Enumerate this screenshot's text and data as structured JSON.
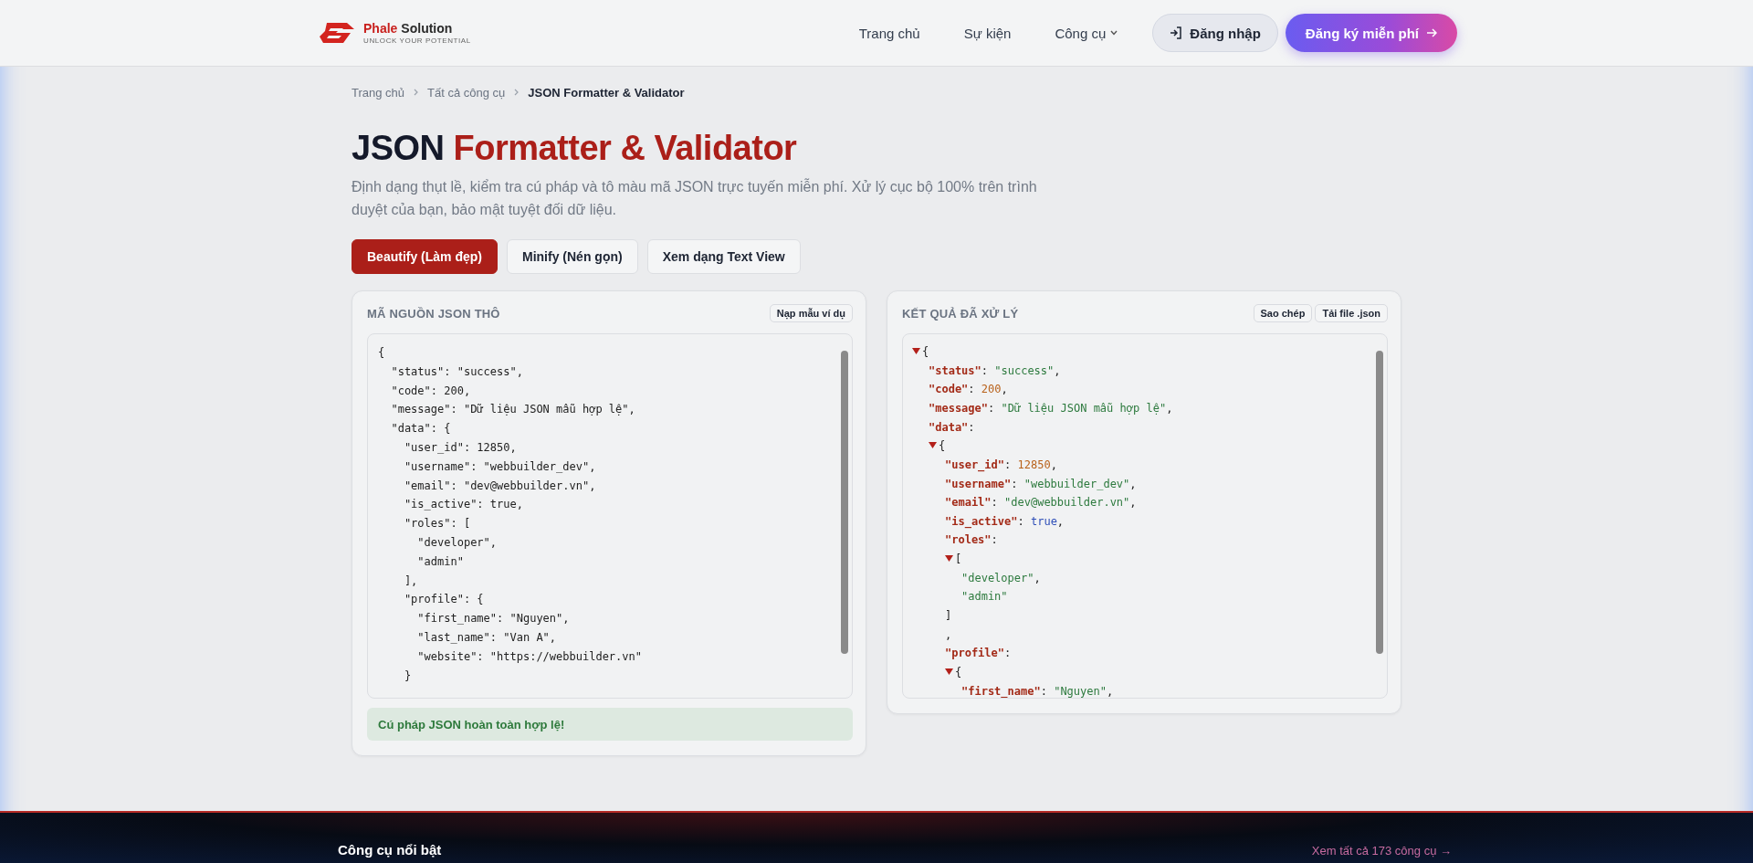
{
  "header": {
    "brand_primary": "Phale",
    "brand_secondary": "Solution",
    "tagline": "UNLOCK YOUR POTENTIAL",
    "nav": [
      {
        "label": "Trang chủ",
        "dropdown": false
      },
      {
        "label": "Sự kiện",
        "dropdown": false
      },
      {
        "label": "Công cụ",
        "dropdown": true
      }
    ],
    "login": "Đăng nhập",
    "signup": "Đăng ký miễn phí"
  },
  "breadcrumb": [
    "Trang chủ",
    "Tất cả công cụ",
    "JSON Formatter & Validator"
  ],
  "title": {
    "lead": "JSON",
    "accent": "Formatter & Validator"
  },
  "subtitle": "Định dạng thụt lề, kiểm tra cú pháp và tô màu mã JSON trực tuyến miễn phí. Xử lý cục bộ 100% trên trình duyệt của bạn, bảo mật tuyệt đối dữ liệu.",
  "modes": [
    {
      "label": "Beautify (Làm đẹp)",
      "selected": true
    },
    {
      "label": "Minify (Nén gọn)",
      "selected": false
    },
    {
      "label": "Xem dạng Text View",
      "selected": false
    }
  ],
  "input_panel": {
    "heading": "MÃ NGUỒN JSON THÔ",
    "action": "Nạp mẫu ví dụ",
    "value": "{\n  \"status\": \"success\",\n  \"code\": 200,\n  \"message\": \"Dữ liệu JSON mẫu hợp lệ\",\n  \"data\": {\n    \"user_id\": 12850,\n    \"username\": \"webbuilder_dev\",\n    \"email\": \"dev@webbuilder.vn\",\n    \"is_active\": true,\n    \"roles\": [\n      \"developer\",\n      \"admin\"\n    ],\n    \"profile\": {\n      \"first_name\": \"Nguyen\",\n      \"last_name\": \"Van A\",\n      \"website\": \"https://webbuilder.vn\"\n    }",
    "status": {
      "kind": "success",
      "text": "Cú pháp JSON hoàn toàn hợp lệ!"
    }
  },
  "output_panel": {
    "heading": "KẾT QUẢ ĐÃ XỬ LÝ",
    "actions": [
      "Sao chép",
      "Tải file .json"
    ],
    "tree": [
      {
        "expanded": true,
        "tokens": [
          {
            "kind": "punct",
            "text": "{"
          }
        ],
        "children": [
          {
            "tokens": [
              {
                "kind": "key",
                "text": "\"status\""
              },
              {
                "kind": "punct",
                "text": ":"
              },
              {
                "kind": "string",
                "text": "\"success\""
              },
              {
                "kind": "punct",
                "text": ","
              }
            ]
          },
          {
            "tokens": [
              {
                "kind": "key",
                "text": "\"code\""
              },
              {
                "kind": "punct",
                "text": ":"
              },
              {
                "kind": "number",
                "text": "200"
              },
              {
                "kind": "punct",
                "text": ","
              }
            ]
          },
          {
            "tokens": [
              {
                "kind": "key",
                "text": "\"message\""
              },
              {
                "kind": "punct",
                "text": ":"
              },
              {
                "kind": "string",
                "text": "\"Dữ liệu JSON mẫu hợp lệ\""
              },
              {
                "kind": "punct",
                "text": ","
              }
            ]
          },
          {
            "tokens": [
              {
                "kind": "key",
                "text": "\"data\""
              },
              {
                "kind": "punct",
                "text": ":"
              }
            ]
          },
          {
            "expanded": true,
            "tokens": [
              {
                "kind": "punct",
                "text": "{"
              }
            ],
            "children": [
              {
                "tokens": [
                  {
                    "kind": "key",
                    "text": "\"user_id\""
                  },
                  {
                    "kind": "punct",
                    "text": ":"
                  },
                  {
                    "kind": "number",
                    "text": "12850"
                  },
                  {
                    "kind": "punct",
                    "text": ","
                  }
                ]
              },
              {
                "tokens": [
                  {
                    "kind": "key",
                    "text": "\"username\""
                  },
                  {
                    "kind": "punct",
                    "text": ":"
                  },
                  {
                    "kind": "string",
                    "text": "\"webbuilder_dev\""
                  },
                  {
                    "kind": "punct",
                    "text": ","
                  }
                ]
              },
              {
                "tokens": [
                  {
                    "kind": "key",
                    "text": "\"email\""
                  },
                  {
                    "kind": "punct",
                    "text": ":"
                  },
                  {
                    "kind": "string",
                    "text": "\"dev@webbuilder.vn\""
                  },
                  {
                    "kind": "punct",
                    "text": ","
                  }
                ]
              },
              {
                "tokens": [
                  {
                    "kind": "key",
                    "text": "\"is_active\""
                  },
                  {
                    "kind": "punct",
                    "text": ":"
                  },
                  {
                    "kind": "boolean",
                    "text": "true"
                  },
                  {
                    "kind": "punct",
                    "text": ","
                  }
                ]
              },
              {
                "tokens": [
                  {
                    "kind": "key",
                    "text": "\"roles\""
                  },
                  {
                    "kind": "punct",
                    "text": ":"
                  }
                ]
              },
              {
                "expanded": true,
                "tokens": [
                  {
                    "kind": "punct",
                    "text": "["
                  }
                ],
                "children": [
                  {
                    "tokens": [
                      {
                        "kind": "string",
                        "text": "\"developer\""
                      },
                      {
                        "kind": "punct",
                        "text": ","
                      }
                    ]
                  },
                  {
                    "tokens": [
                      {
                        "kind": "string",
                        "text": "\"admin\""
                      }
                    ]
                  }
                ]
              },
              {
                "tokens": [
                  {
                    "kind": "punct",
                    "text": "]"
                  }
                ]
              },
              {
                "tokens": [
                  {
                    "kind": "punct",
                    "text": ","
                  }
                ]
              },
              {
                "tokens": [
                  {
                    "kind": "key",
                    "text": "\"profile\""
                  },
                  {
                    "kind": "punct",
                    "text": ":"
                  }
                ]
              },
              {
                "expanded": true,
                "tokens": [
                  {
                    "kind": "punct",
                    "text": "{"
                  }
                ],
                "children": [
                  {
                    "tokens": [
                      {
                        "kind": "key",
                        "text": "\"first_name\""
                      },
                      {
                        "kind": "punct",
                        "text": ":"
                      },
                      {
                        "kind": "string",
                        "text": "\"Nguyen\""
                      },
                      {
                        "kind": "punct",
                        "text": ","
                      }
                    ]
                  }
                ]
              }
            ]
          }
        ]
      }
    ]
  },
  "footer": {
    "heading": "Công cụ nổi bật",
    "link": "Xem tất cả 173 công cụ →"
  }
}
